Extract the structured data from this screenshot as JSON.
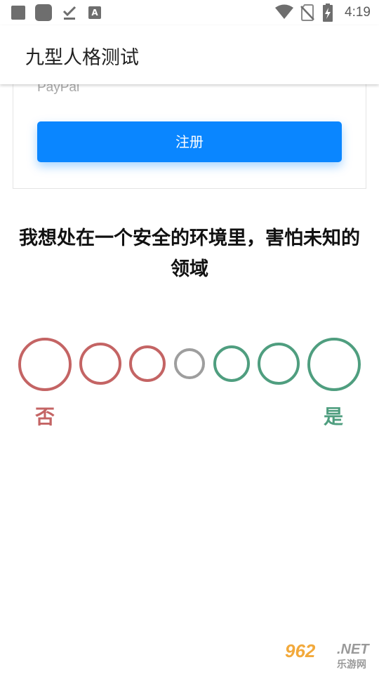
{
  "status_bar": {
    "time": "4:19",
    "icons": [
      "notification-square-icon",
      "app-square-icon",
      "download-done-icon",
      "a-icon",
      "wifi-icon",
      "no-sim-icon",
      "battery-charging-icon"
    ]
  },
  "app_bar": {
    "title": "九型人格测试"
  },
  "card": {
    "payment_option": "PayPal",
    "register_label": "注册"
  },
  "question": {
    "text": "我想处在一个安全的环境里，害怕未知的领域"
  },
  "scale": {
    "no_label": "否",
    "yes_label": "是",
    "options": [
      {
        "id": "strong-no",
        "color": "#c46464"
      },
      {
        "id": "no",
        "color": "#c46464"
      },
      {
        "id": "slight-no",
        "color": "#c46464"
      },
      {
        "id": "neutral",
        "color": "#9e9e9e"
      },
      {
        "id": "slight-yes",
        "color": "#4f9e7f"
      },
      {
        "id": "yes",
        "color": "#4f9e7f"
      },
      {
        "id": "strong-yes",
        "color": "#4f9e7f"
      }
    ]
  },
  "watermark": {
    "number": "962",
    "domain": ".NET",
    "name": "乐游网"
  }
}
